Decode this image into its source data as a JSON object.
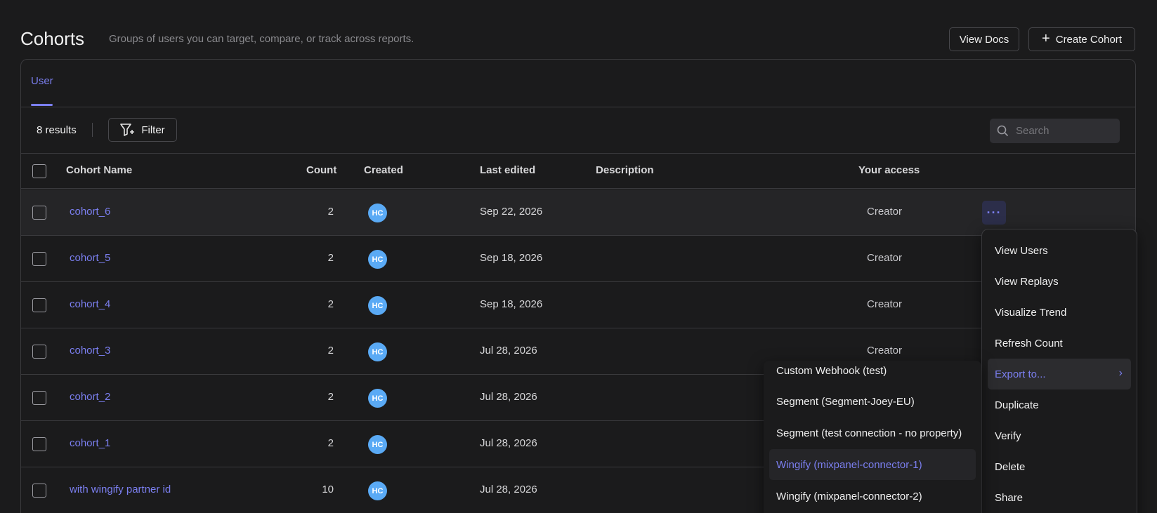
{
  "header": {
    "title": "Cohorts",
    "subtitle": "Groups of users you can target, compare, or track across reports.",
    "view_docs": "View Docs",
    "create_cohort": "Create Cohort"
  },
  "tabs": [
    {
      "label": "User",
      "active": true
    }
  ],
  "toolbar": {
    "results": "8 results",
    "filter": "Filter",
    "search_placeholder": "Search"
  },
  "columns": {
    "name": "Cohort Name",
    "count": "Count",
    "created": "Created",
    "last_edited": "Last edited",
    "description": "Description",
    "access": "Your access"
  },
  "rows": [
    {
      "name": "cohort_6",
      "count": "2",
      "creator": "HC",
      "edited": "Sep 22, 2026",
      "access": "Creator"
    },
    {
      "name": "cohort_5",
      "count": "2",
      "creator": "HC",
      "edited": "Sep 18, 2026",
      "access": "Creator"
    },
    {
      "name": "cohort_4",
      "count": "2",
      "creator": "HC",
      "edited": "Sep 18, 2026",
      "access": "Creator"
    },
    {
      "name": "cohort_3",
      "count": "2",
      "creator": "HC",
      "edited": "Jul 28, 2026",
      "access": "Creator"
    },
    {
      "name": "cohort_2",
      "count": "2",
      "creator": "HC",
      "edited": "Jul 28, 2026",
      "access": ""
    },
    {
      "name": "cohort_1",
      "count": "2",
      "creator": "HC",
      "edited": "Jul 28, 2026",
      "access": ""
    },
    {
      "name": "with wingify partner id",
      "count": "10",
      "creator": "HC",
      "edited": "Jul 28, 2026",
      "access": ""
    }
  ],
  "row_menu": {
    "items": [
      "View Users",
      "View Replays",
      "Visualize Trend",
      "Refresh Count",
      "Export to...",
      "Duplicate",
      "Verify",
      "Delete",
      "Share"
    ],
    "active_index": 4
  },
  "export_menu": {
    "items": [
      "Custom Webhook (test)",
      "Segment (Segment-Joey-EU)",
      "Segment (test connection - no property)",
      "Wingify (mixpanel-connector-1)",
      "Wingify (mixpanel-connector-2)"
    ],
    "active_index": 3
  },
  "colors": {
    "accent": "#7b7ff0",
    "avatar": "#5aaaf5",
    "background": "#1b1b1c"
  }
}
